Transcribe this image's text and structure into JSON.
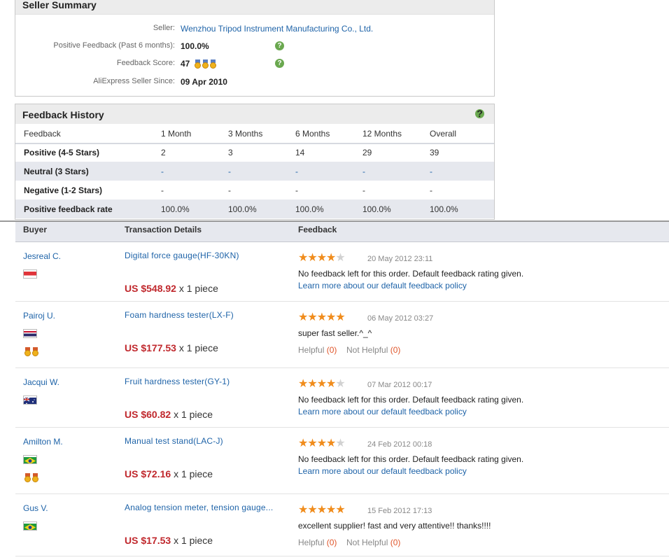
{
  "seller_summary": {
    "title": "Seller Summary",
    "seller_label": "Seller:",
    "seller_name": "Wenzhou Tripod Instrument Manufacturing Co., Ltd.",
    "positive_feedback_label": "Positive Feedback (Past 6 months):",
    "positive_feedback_value": "100.0%",
    "feedback_score_label": "Feedback Score:",
    "feedback_score_value": "47",
    "seller_since_label": "AliExpress Seller Since:",
    "seller_since_value": "09 Apr 2010",
    "help_glyph": "?"
  },
  "feedback_history": {
    "title": "Feedback History",
    "help_glyph": "?",
    "columns": [
      "Feedback",
      "1 Month",
      "3 Months",
      "6 Months",
      "12 Months",
      "Overall"
    ],
    "rows": [
      {
        "label": "Positive (4-5 Stars)",
        "values": [
          "2",
          "3",
          "14",
          "29",
          "39"
        ]
      },
      {
        "label": "Neutral (3 Stars)",
        "values": [
          "-",
          "-",
          "-",
          "-",
          "-"
        ]
      },
      {
        "label": "Negative (1-2 Stars)",
        "values": [
          "-",
          "-",
          "-",
          "-",
          "-"
        ]
      },
      {
        "label": "Positive feedback rate",
        "values": [
          "100.0%",
          "100.0%",
          "100.0%",
          "100.0%",
          "100.0%"
        ]
      }
    ]
  },
  "reviews": {
    "columns": [
      "Buyer",
      "Transaction Details",
      "Feedback"
    ],
    "items": [
      {
        "buyer": "Jesreal C.",
        "flag": "singapore",
        "medals": 0,
        "product": "Digital force gauge(HF-30KN)",
        "price": "US $548.92",
        "quantity": "x 1 piece",
        "stars": 4,
        "date": "20 May 2012 23:11",
        "comment": "No feedback left for this order. Default feedback rating given.",
        "learn_more": "Learn more about our default feedback policy"
      },
      {
        "buyer": "Pairoj U.",
        "flag": "thailand",
        "medals": 2,
        "product": "Foam hardness tester(LX-F)",
        "price": "US $177.53",
        "quantity": "x 1 piece",
        "stars": 5,
        "date": "06 May 2012 03:27",
        "comment": "super fast seller.^_^",
        "helpful_label": "Helpful",
        "helpful_count": "(0)",
        "not_helpful_label": "Not Helpful",
        "not_helpful_count": "(0)"
      },
      {
        "buyer": "Jacqui W.",
        "flag": "australia",
        "medals": 0,
        "product": "Fruit hardness tester(GY-1)",
        "price": "US $60.82",
        "quantity": "x 1 piece",
        "stars": 4,
        "date": "07 Mar 2012 00:17",
        "comment": "No feedback left for this order. Default feedback rating given.",
        "learn_more": "Learn more about our default feedback policy"
      },
      {
        "buyer": "Amilton M.",
        "flag": "brazil",
        "medals": 2,
        "product": "Manual test stand(LAC-J)",
        "price": "US $72.16",
        "quantity": "x 1 piece",
        "stars": 4,
        "date": "24 Feb 2012 00:18",
        "comment": "No feedback left for this order. Default feedback rating given.",
        "learn_more": "Learn more about our default feedback policy"
      },
      {
        "buyer": "Gus V.",
        "flag": "brazil",
        "medals": 0,
        "product": "Analog tension meter, tension gauge...",
        "price": "US $17.53",
        "quantity": "x 1 piece",
        "stars": 5,
        "date": "15 Feb 2012 17:13",
        "comment": "excellent supplier! fast and very attentive!! thanks!!!!",
        "helpful_label": "Helpful",
        "helpful_count": "(0)",
        "not_helpful_label": "Not Helpful",
        "not_helpful_count": "(0)"
      }
    ]
  },
  "colors": {
    "link": "#1e63a8",
    "price": "#c0282d",
    "star_on": "#f08c1c",
    "star_off": "#d2d2d2",
    "help_icon": "#6aa84f"
  }
}
